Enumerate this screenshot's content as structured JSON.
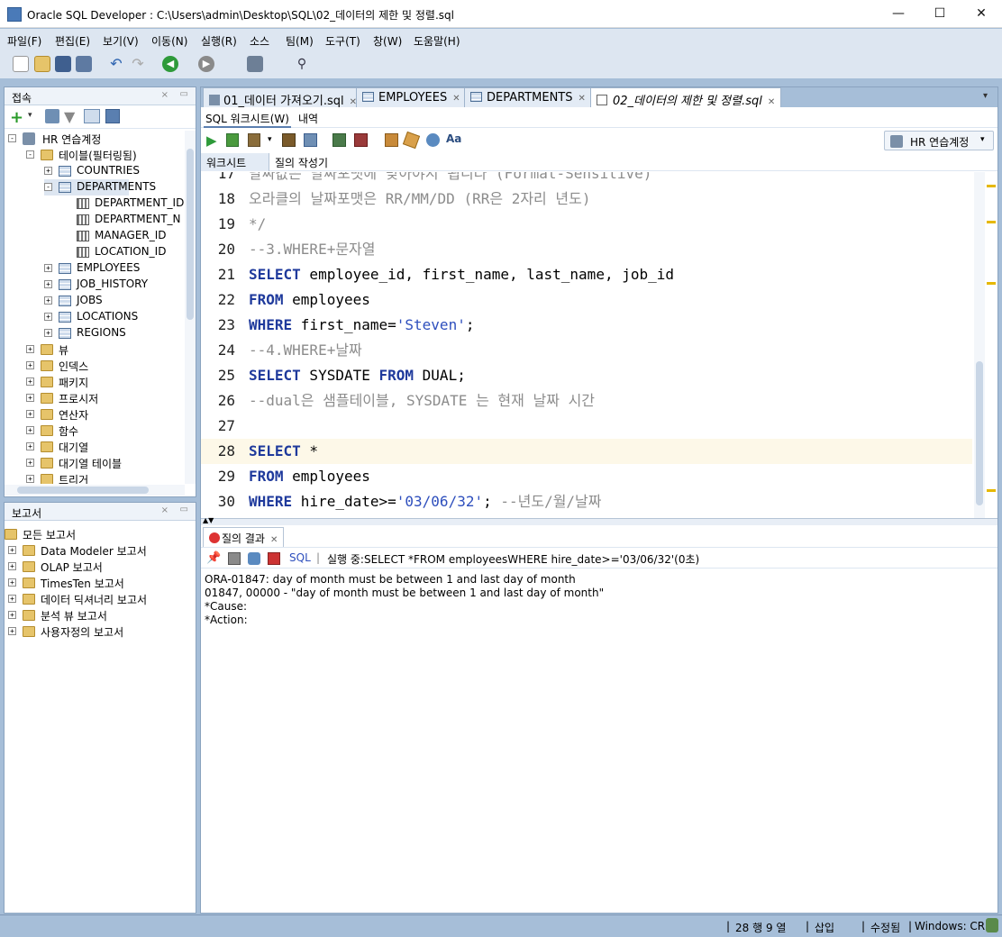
{
  "window": {
    "title": "Oracle SQL Developer : C:\\Users\\admin\\Desktop\\SQL\\02_데이터의 제한 및 정렬.sql",
    "minimize": "—",
    "maximize": "☐",
    "close": "✕"
  },
  "menu": [
    "파일(F)",
    "편집(E)",
    "보기(V)",
    "이동(N)",
    "실행(R)",
    "소스",
    "팀(M)",
    "도구(T)",
    "창(W)",
    "도움말(H)"
  ],
  "connections_panel": {
    "title": "접속",
    "tree": [
      {
        "label": "HR 연습계정",
        "toggle": "-",
        "icon": "db"
      },
      {
        "label": "테이블(필터링됨)",
        "toggle": "-",
        "icon": "folder"
      },
      {
        "label": "COUNTRIES",
        "toggle": "+",
        "icon": "table"
      },
      {
        "label": "DEPARTMENTS",
        "toggle": "-",
        "icon": "table"
      },
      {
        "label": "DEPARTMENT_ID",
        "toggle": "",
        "icon": "col"
      },
      {
        "label": "DEPARTMENT_N",
        "toggle": "",
        "icon": "col"
      },
      {
        "label": "MANAGER_ID",
        "toggle": "",
        "icon": "col"
      },
      {
        "label": "LOCATION_ID",
        "toggle": "",
        "icon": "col"
      },
      {
        "label": "EMPLOYEES",
        "toggle": "+",
        "icon": "table"
      },
      {
        "label": "JOB_HISTORY",
        "toggle": "+",
        "icon": "table"
      },
      {
        "label": "JOBS",
        "toggle": "+",
        "icon": "table"
      },
      {
        "label": "LOCATIONS",
        "toggle": "+",
        "icon": "table"
      },
      {
        "label": "REGIONS",
        "toggle": "+",
        "icon": "table"
      },
      {
        "label": "뷰",
        "toggle": "+",
        "icon": "folder"
      },
      {
        "label": "인덱스",
        "toggle": "+",
        "icon": "folder"
      },
      {
        "label": "패키지",
        "toggle": "+",
        "icon": "folder"
      },
      {
        "label": "프로시저",
        "toggle": "+",
        "icon": "folder"
      },
      {
        "label": "연산자",
        "toggle": "+",
        "icon": "folder"
      },
      {
        "label": "함수",
        "toggle": "+",
        "icon": "folder"
      },
      {
        "label": "대기열",
        "toggle": "+",
        "icon": "folder"
      },
      {
        "label": "대기열 테이블",
        "toggle": "+",
        "icon": "folder"
      },
      {
        "label": "트리거",
        "toggle": "+",
        "icon": "folder"
      }
    ]
  },
  "reports_panel": {
    "title": "보고서",
    "items": [
      "모든 보고서",
      "Data Modeler 보고서",
      "OLAP 보고서",
      "TimesTen 보고서",
      "데이터 딕셔너리 보고서",
      "분석 뷰 보고서",
      "사용자정의 보고서"
    ]
  },
  "tabs": [
    {
      "label": "01_데이터 가져오기.sql",
      "active": false
    },
    {
      "label": "EMPLOYEES",
      "active": false
    },
    {
      "label": "DEPARTMENTS",
      "active": false
    },
    {
      "label": "02_데이터의 제한 및 정렬.sql",
      "active": true
    }
  ],
  "subtabs": {
    "worksheet": "SQL 워크시트(W)",
    "history": "내역"
  },
  "connection_selector": "HR 연습계정",
  "editor_tabs": {
    "worksheet": "워크시트",
    "query_builder": "질의 작성기"
  },
  "editor_lines": [
    {
      "n": "17",
      "parts": [
        {
          "t": "cm",
          "v": "날짜값은 날짜포맷에 맞아야지 됩니다 (Format-Sensitive)"
        }
      ]
    },
    {
      "n": "18",
      "parts": [
        {
          "t": "cm",
          "v": "오라클의 날짜포맷은 RR/MM/DD (RR은 2자리 년도)"
        }
      ]
    },
    {
      "n": "19",
      "parts": [
        {
          "t": "cm",
          "v": "*/"
        }
      ]
    },
    {
      "n": "20",
      "parts": [
        {
          "t": "cm",
          "v": "--3.WHERE+문자열"
        }
      ]
    },
    {
      "n": "21",
      "parts": [
        {
          "t": "kw",
          "v": "SELECT"
        },
        {
          "t": "",
          "v": " employee_id, first_name, last_name, job_id"
        }
      ]
    },
    {
      "n": "22",
      "parts": [
        {
          "t": "kw",
          "v": "FROM"
        },
        {
          "t": "",
          "v": " employees"
        }
      ]
    },
    {
      "n": "23",
      "parts": [
        {
          "t": "kw",
          "v": "WHERE"
        },
        {
          "t": "",
          "v": " first_name="
        },
        {
          "t": "str",
          "v": "'Steven'"
        },
        {
          "t": "",
          "v": ";"
        }
      ]
    },
    {
      "n": "24",
      "parts": [
        {
          "t": "cm",
          "v": "--4.WHERE+날짜"
        }
      ]
    },
    {
      "n": "25",
      "parts": [
        {
          "t": "kw",
          "v": "SELECT"
        },
        {
          "t": "",
          "v": " SYSDATE "
        },
        {
          "t": "kw",
          "v": "FROM"
        },
        {
          "t": "",
          "v": " DUAL;"
        }
      ]
    },
    {
      "n": "26",
      "parts": [
        {
          "t": "cm",
          "v": "--dual은 샘플테이블, SYSDATE 는 현재 날짜 시간"
        }
      ]
    },
    {
      "n": "27",
      "parts": []
    },
    {
      "n": "28",
      "parts": [
        {
          "t": "kw",
          "v": "SELECT"
        },
        {
          "t": "",
          "v": " *"
        }
      ]
    },
    {
      "n": "29",
      "parts": [
        {
          "t": "kw",
          "v": "FROM"
        },
        {
          "t": "",
          "v": " employees"
        }
      ]
    },
    {
      "n": "30",
      "parts": [
        {
          "t": "kw",
          "v": "WHERE"
        },
        {
          "t": "",
          "v": " hire_date>="
        },
        {
          "t": "str",
          "v": "'03/06/32'"
        },
        {
          "t": "",
          "v": "; "
        },
        {
          "t": "cm",
          "v": "--년도/월/날짜"
        }
      ]
    }
  ],
  "results": {
    "tab_label": "질의 결과",
    "sql_link": "SQL",
    "status": "실행 중:SELECT *FROM employeesWHERE hire_date>='03/06/32'(0초)",
    "messages": [
      "ORA-01847: day of month must be between 1 and last day of month",
      "01847, 00000 -  \"day of month must be between 1 and last day of month\"",
      "*Cause:",
      "*Action:"
    ]
  },
  "status_bar": {
    "position": "28 행 9 열",
    "mode": "삽입",
    "modified": "수정됨",
    "line_ending": "Windows: CR"
  },
  "colors": {
    "keyword": "#1f3a9c",
    "string": "#2e4fbd",
    "comment": "#8c8c8c",
    "frame": "#a6bed8"
  }
}
